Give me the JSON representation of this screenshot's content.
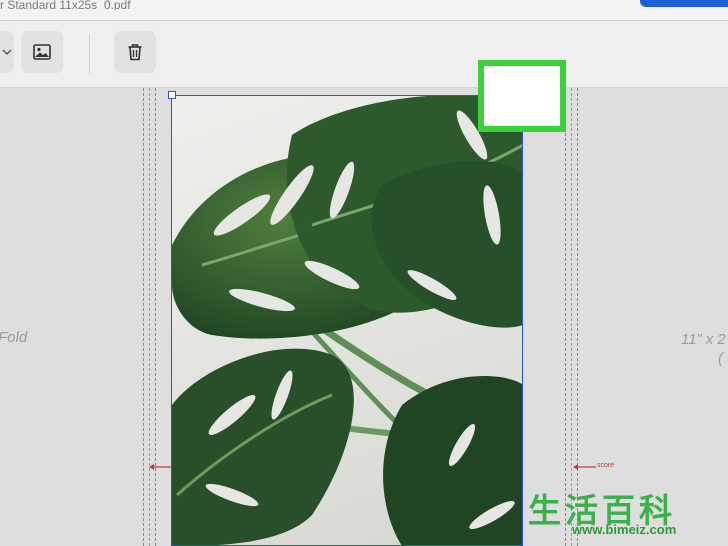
{
  "header": {
    "file_name": "r Standard 11x25s_0.pdf"
  },
  "toolbar": {
    "buttons": [
      {
        "icon": "dropdown-stub-icon"
      },
      {
        "icon": "image-icon"
      },
      {
        "icon": "trash-icon"
      }
    ]
  },
  "canvas": {
    "left_fold_label": "Fold",
    "right_fold_label": "11” x 2",
    "right_fold_sub": "(",
    "score_label": "score"
  },
  "watermark": {
    "chars": "生活百科",
    "url": "www.bimeiz.com"
  },
  "colors": {
    "selection": "#2f57c9",
    "highlight": "#3ad13a",
    "primary_button": "#1a5fd6",
    "leaf": "#2f5e2e"
  }
}
